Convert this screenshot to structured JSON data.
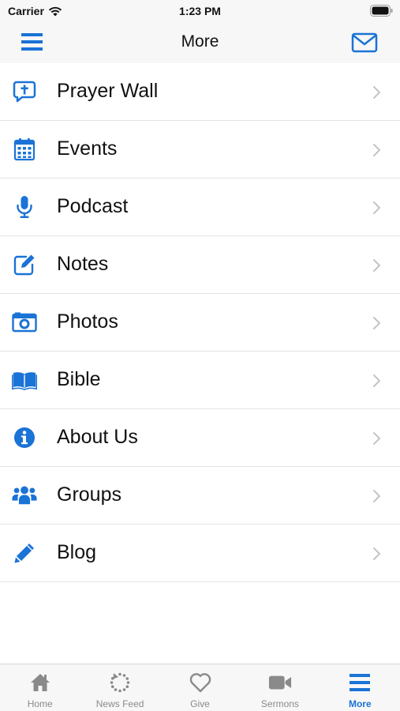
{
  "colors": {
    "accent": "#1a73d6",
    "inactive": "#8a8a8a",
    "chevron": "#c4c4c4"
  },
  "status_bar": {
    "carrier": "Carrier",
    "time": "1:23 PM"
  },
  "nav_bar": {
    "title": "More",
    "left_icon": "hamburger-menu-icon",
    "right_icon": "mail-icon"
  },
  "menu": {
    "items": [
      {
        "label": "Prayer Wall",
        "icon": "prayer-bubble-icon"
      },
      {
        "label": "Events",
        "icon": "calendar-icon"
      },
      {
        "label": "Podcast",
        "icon": "microphone-icon"
      },
      {
        "label": "Notes",
        "icon": "edit-note-icon"
      },
      {
        "label": "Photos",
        "icon": "camera-icon"
      },
      {
        "label": "Bible",
        "icon": "open-book-icon"
      },
      {
        "label": "About Us",
        "icon": "info-icon"
      },
      {
        "label": "Groups",
        "icon": "users-icon"
      },
      {
        "label": "Blog",
        "icon": "pencil-icon"
      }
    ]
  },
  "tab_bar": {
    "items": [
      {
        "label": "Home",
        "icon": "home-icon"
      },
      {
        "label": "News Feed",
        "icon": "refresh-icon"
      },
      {
        "label": "Give",
        "icon": "heart-icon"
      },
      {
        "label": "Sermons",
        "icon": "video-camera-icon"
      },
      {
        "label": "More",
        "icon": "hamburger-menu-icon"
      }
    ],
    "active": "More"
  }
}
